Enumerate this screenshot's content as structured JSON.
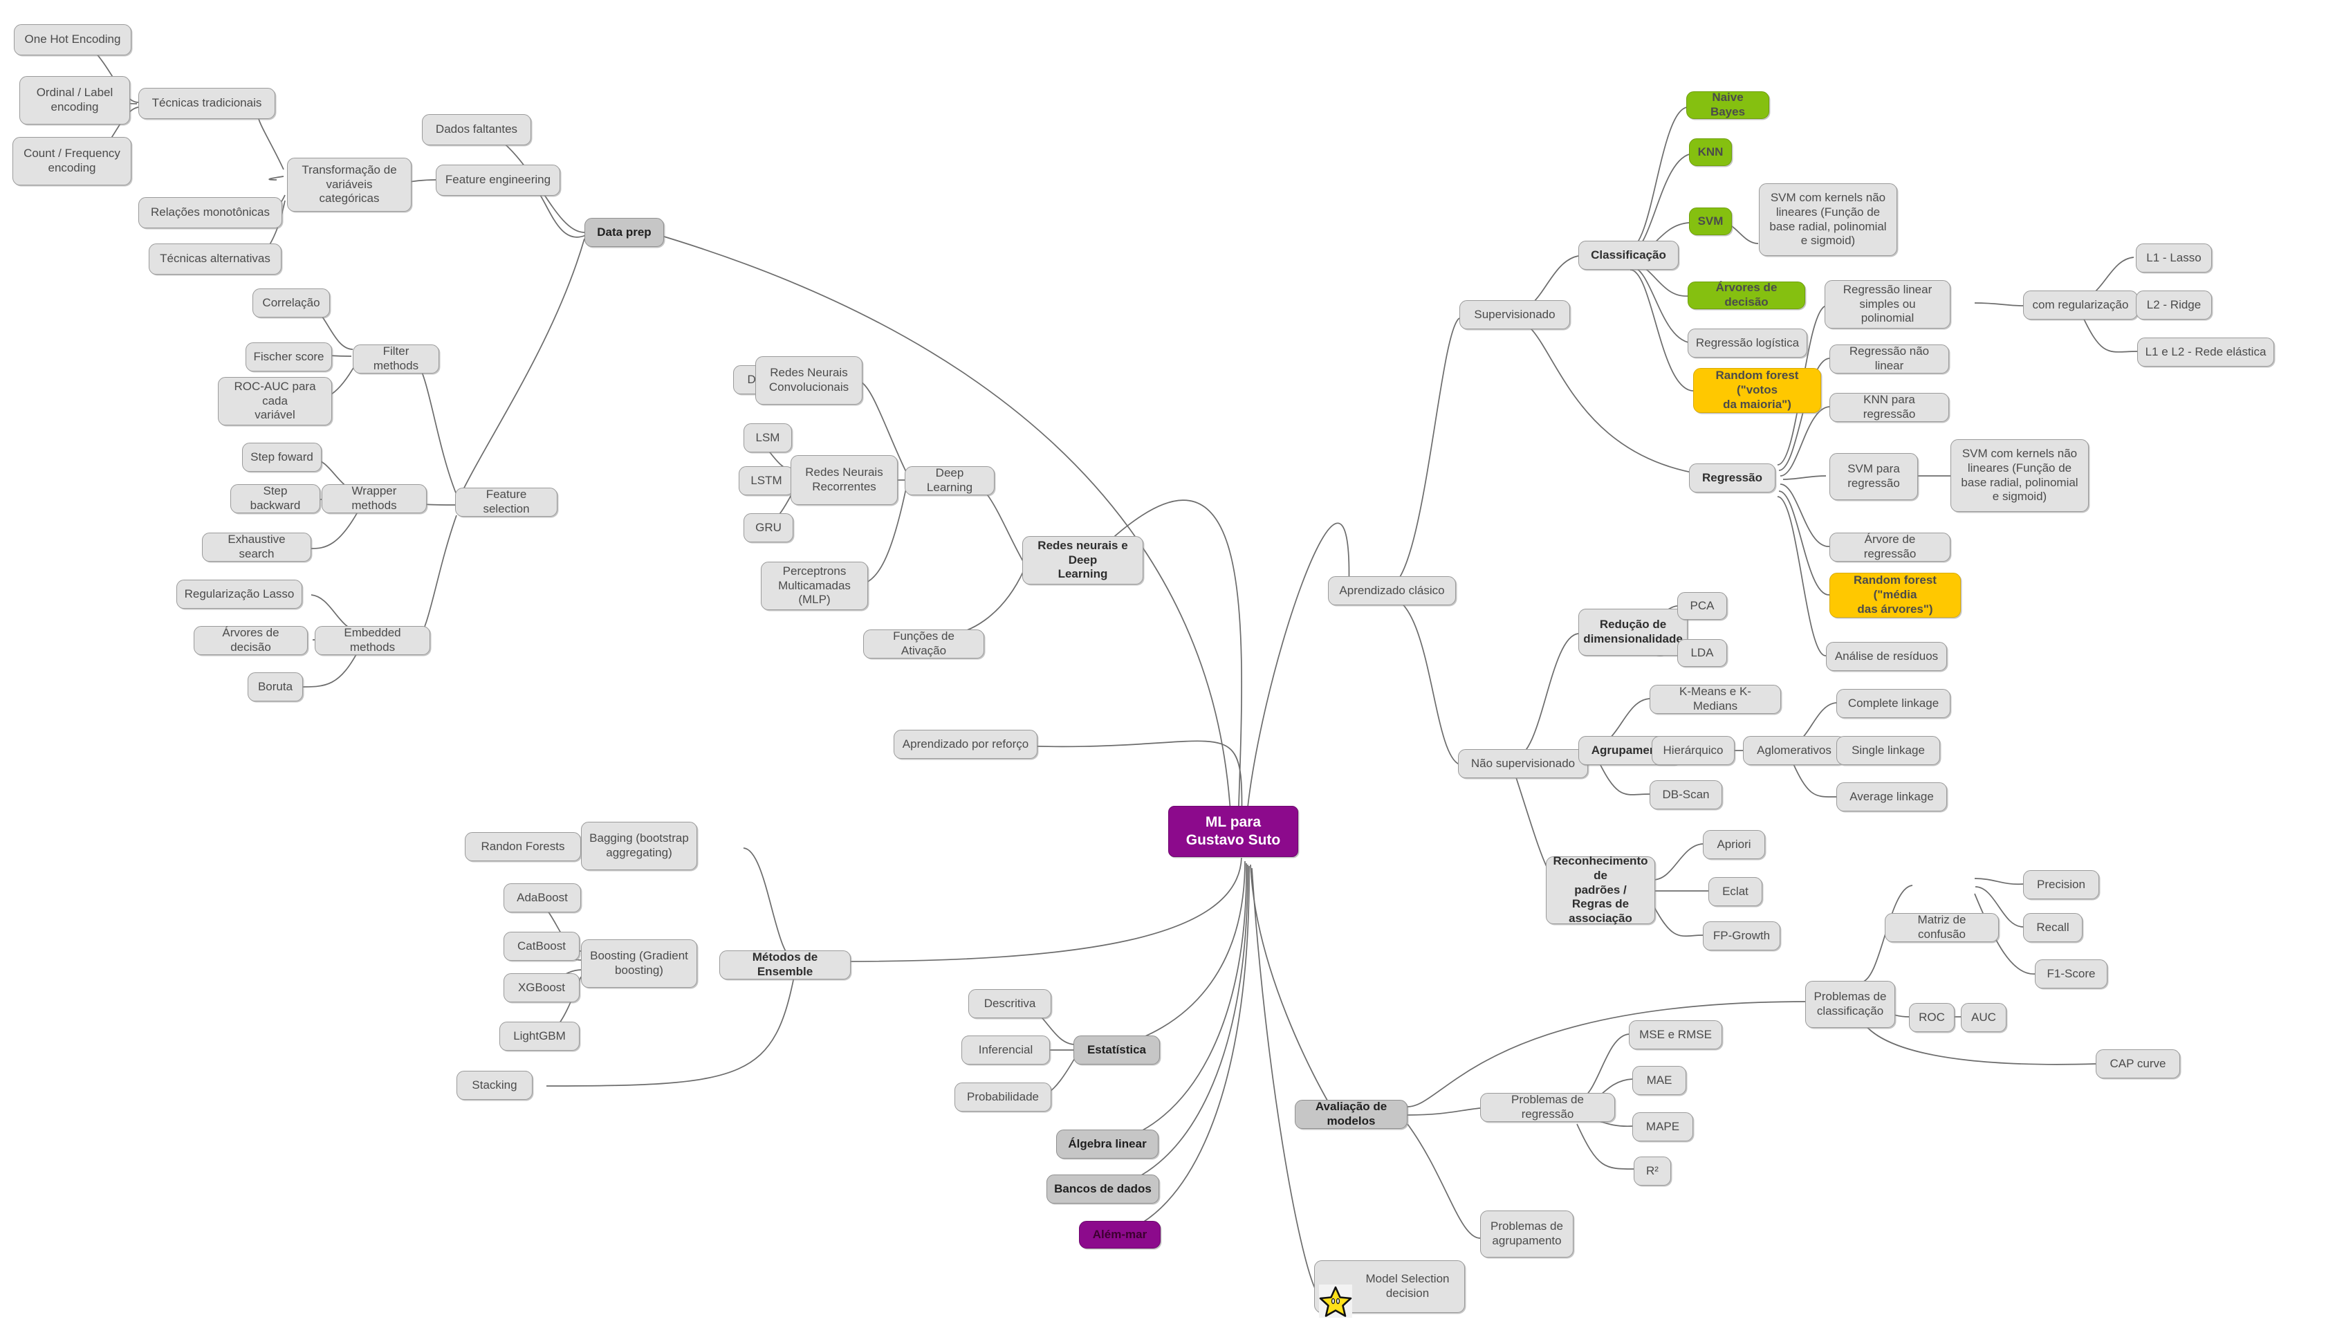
{
  "title": "ML para Gustavo Suto",
  "colors": {
    "root_purple": "#8c0a8c",
    "green": "#85c010",
    "yellow": "#ffc800",
    "node_gray": "#e2e2e2",
    "level1_gray": "#c6c6c6",
    "edge_gray": "#6b6b6b",
    "text_gray": "#4b4b4b"
  },
  "icons": {
    "star": "star-icon"
  },
  "nodes": {
    "root": "ML para Gustavo Suto",
    "data_prep": "Data prep",
    "transformacao_var_cat": "Transformação de\nvariáveis categóricas",
    "tecnicas_tradicionais": "Técnicas tradicionais",
    "one_hot": "One Hot Encoding",
    "ordinal_label": "Ordinal / Label\nencoding",
    "count_freq": "Count / Frequency\nencoding",
    "relacoes_monotonicas": "Relações monotônicas",
    "tecnicas_alternativas": "Técnicas alternativas",
    "feature_engineering": "Feature engineering",
    "dados_faltantes": "Dados faltantes",
    "feature_selection": "Feature selection",
    "filter_methods": "Filter methods",
    "correlacao": "Correlação",
    "fischer_score": "Fischer score",
    "roc_auc_var": "ROC-AUC para cada\nvariável",
    "wrapper_methods": "Wrapper methods",
    "step_foward": "Step foward",
    "step_backward": "Step backward",
    "exhaustive_search": "Exhaustive search",
    "embedded_methods": "Embedded methods",
    "regularizacao_lasso": "Regularização Lasso",
    "arvores_decisao_fs": "Árvores de decisão",
    "boruta": "Boruta",
    "redes_neurais_dl": "Redes neurais e Deep\nLearning",
    "deep_learning": "Deep Learning",
    "redes_conv": "Redes Neurais\nConvolucionais",
    "dcnn": "DCNN",
    "redes_recorrentes": "Redes Neurais\nRecorrentes",
    "lsm": "LSM",
    "lstm": "LSTM",
    "gru": "GRU",
    "mlp": "Perceptrons\nMulticamadas (MLP)",
    "funcoes_ativacao": "Funções de Ativação",
    "aprendizado_reforco": "Aprendizado por reforço",
    "aprendizado_classico": "Aprendizado clásico",
    "supervisionado": "Supervisionado",
    "classificacao": "Classificação",
    "naive_bayes": "Naive Bayes",
    "knn": "KNN",
    "svm": "SVM",
    "svm_kernels_clf": "SVM com kernels não\nlineares (Função de\nbase radial, polinomial\ne sigmoid)",
    "arvores_decisao_clf": "Árvores de decisão",
    "regressao_logistica": "Regressão logística",
    "random_forest_votos": "Random forest (\"votos\nda maioria\")",
    "regressao": "Regressão",
    "reg_linear_simples": "Regressão linear\nsimples ou polinomial",
    "com_regularizacao": "com regularização",
    "l1_lasso": "L1 - Lasso",
    "l2_ridge": "L2 - Ridge",
    "l1_l2_elastica": "L1 e L2 - Rede elástica",
    "reg_nao_linear": "Regressão não linear",
    "knn_regressao": "KNN para regressão",
    "svm_regressao": "SVM para\nregressão",
    "svm_kernels_reg": "SVM com kernels não\nlineares (Função de\nbase radial, polinomial\ne sigmoid)",
    "arvore_regressao": "Árvore de regressão",
    "random_forest_media": "Random forest (\"média\ndas árvores\")",
    "analise_residuos": "Análise de resíduos",
    "nao_supervisionado": "Não supervisionado",
    "reducao_dimensionalidade": "Redução de\ndimensionalidade",
    "pca": "PCA",
    "lda": "LDA",
    "agrupamento": "Agrupamento",
    "kmeans": "K-Means e K-Medians",
    "hierarquico": "Hierárquico",
    "aglomerativos": "Aglomerativos",
    "complete_linkage": "Complete linkage",
    "single_linkage": "Single linkage",
    "average_linkage": "Average linkage",
    "dbscan": "DB-Scan",
    "reconhecimento_padroes": "Reconhecimento de\npadrões / Regras de\nassociação",
    "apriori": "Apriori",
    "eclat": "Eclat",
    "fpgrowth": "FP-Growth",
    "metodos_ensemble": "Métodos de Ensemble",
    "bagging": "Bagging (bootstrap\naggregating)",
    "randon_forests": "Randon Forests",
    "boosting": "Boosting (Gradient\nboosting)",
    "adaboost": "AdaBoost",
    "catboost": "CatBoost",
    "xgboost": "XGBoost",
    "lightgbm": "LightGBM",
    "stacking": "Stacking",
    "estatistica": "Estatística",
    "descritiva": "Descritiva",
    "inferencial": "Inferencial",
    "probabilidade": "Probabilidade",
    "algebra_linear": "Álgebra linear",
    "bancos_dados": "Bancos de dados",
    "alem_mar": "Além-mar",
    "avaliacao_modelos": "Avaliação de modelos",
    "problemas_classificacao": "Problemas de\nclassificação",
    "matriz_confusao": "Matriz de confusão",
    "precision": "Precision",
    "recall": "Recall",
    "f1_score": "F1-Score",
    "roc": "ROC",
    "auc": "AUC",
    "cap_curve": "CAP curve",
    "problemas_regressao": "Problemas de regressão",
    "mse_rmse": "MSE e RMSE",
    "mae": "MAE",
    "mape": "MAPE",
    "r2": "R²",
    "problemas_agrupamento": "Problemas de\nagrupamento",
    "model_selection": "Model Selection\ndecision"
  }
}
